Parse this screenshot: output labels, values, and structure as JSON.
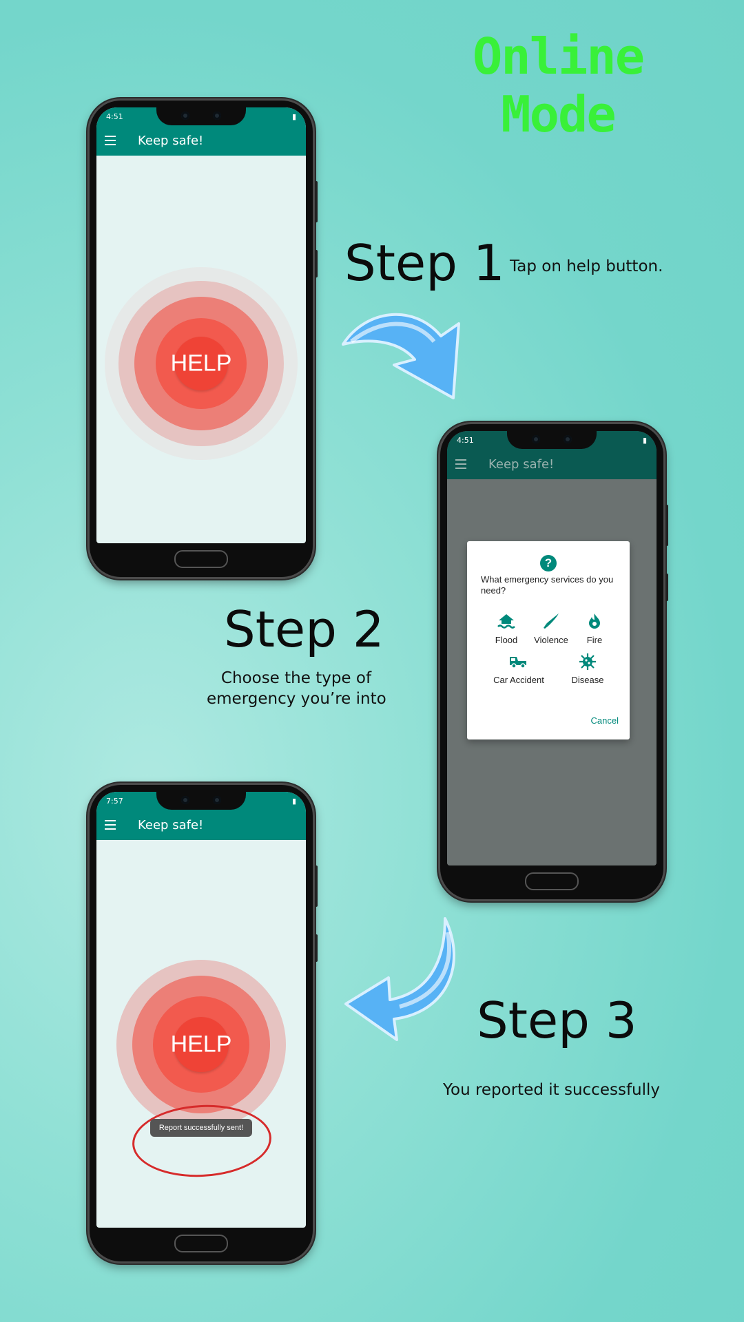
{
  "page": {
    "title": "Online Mode"
  },
  "steps": [
    {
      "heading": "Step 1",
      "description": "Tap on help button."
    },
    {
      "heading": "Step 2",
      "description_line1": "Choose the type of",
      "description_line2": "emergency you’re into"
    },
    {
      "heading": "Step 3",
      "description": "You reported it successfully"
    }
  ],
  "phones": [
    {
      "time": "4:51",
      "app_title": "Keep safe!",
      "help_label": "HELP",
      "statusbar_color": "#00897b"
    },
    {
      "time": "4:51",
      "app_title": "Keep safe!",
      "statusbar_color": "#0a5a52",
      "dialog": {
        "question": "What emergency services do you need?",
        "options": [
          {
            "label": "Flood",
            "icon": "flood-icon"
          },
          {
            "label": "Violence",
            "icon": "knife-icon"
          },
          {
            "label": "Fire",
            "icon": "fire-icon"
          },
          {
            "label": "Car Accident",
            "icon": "tow-truck-icon"
          },
          {
            "label": "Disease",
            "icon": "virus-icon"
          }
        ],
        "cancel": "Cancel"
      }
    },
    {
      "time": "7:57",
      "app_title": "Keep safe!",
      "help_label": "HELP",
      "toast": "Report successfully sent!",
      "statusbar_color": "#00897b"
    }
  ],
  "colors": {
    "accent": "#00897b",
    "title_green": "#39f039",
    "help_red": "#f04438",
    "arrow_blue": "#4aa8f0"
  }
}
